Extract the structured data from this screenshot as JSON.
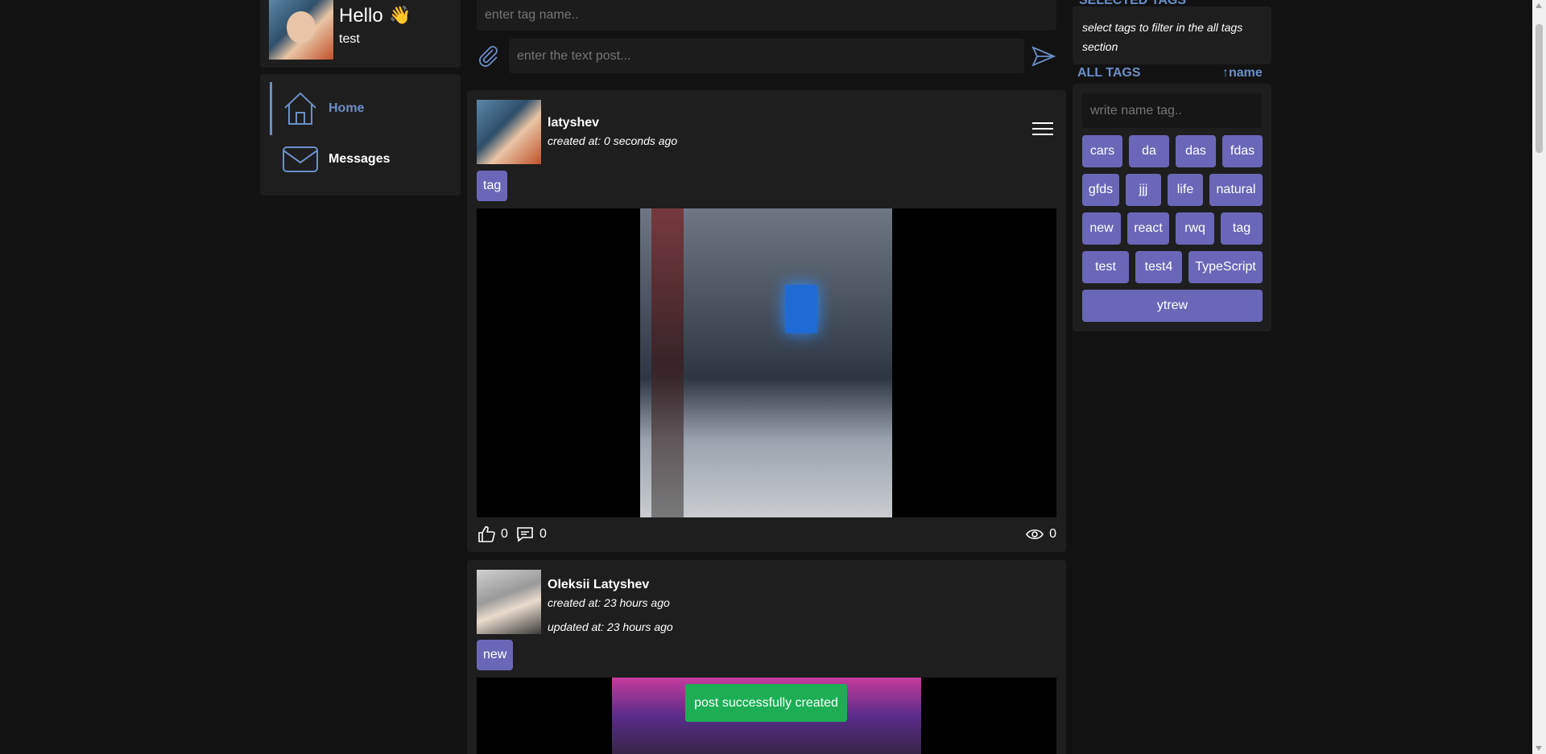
{
  "profile": {
    "greeting": "Hello",
    "wave": "👋",
    "username": "test"
  },
  "nav": {
    "home": "Home",
    "messages": "Messages"
  },
  "composer": {
    "tag_placeholder": "enter tag name..",
    "text_placeholder": "enter the text post..."
  },
  "posts": [
    {
      "author": "latyshev",
      "created": "created at: 0 seconds ago",
      "tag": "tag",
      "likes": "0",
      "comments": "0",
      "views": "0"
    },
    {
      "author": "Oleksii Latyshev",
      "created": "created at: 23 hours ago",
      "updated": "updated at: 23 hours ago",
      "tag": "new"
    }
  ],
  "toast": "post successfully created",
  "sidebar": {
    "selected_title": "SELECTED TAGS",
    "selected_hint": "select tags to filter in the all tags section",
    "all_title": "ALL TAGS",
    "sort_label": "↑name",
    "search_placeholder": "write name tag..",
    "tags": [
      "cars",
      "da",
      "das",
      "fdas",
      "gfds",
      "jjj",
      "life",
      "natural",
      "new",
      "react",
      "rwq",
      "tag",
      "test",
      "test4",
      "TypeScript",
      "ytrew"
    ]
  },
  "colors": {
    "accent": "#6a8fc8",
    "tag_bg": "#6a67b8",
    "toast_bg": "#1dae55",
    "panel": "#1e1e1e",
    "page": "#121212"
  }
}
